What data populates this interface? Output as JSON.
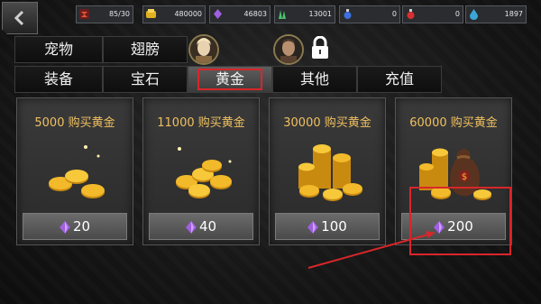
{
  "resources": [
    {
      "icon": "stamina-icon",
      "value": "85/30"
    },
    {
      "icon": "gold-coin-icon",
      "value": "480000"
    },
    {
      "icon": "purple-gem-icon",
      "value": "46803"
    },
    {
      "icon": "green-crystal-icon",
      "value": "13001"
    },
    {
      "icon": "blue-potion-icon",
      "value": "0"
    },
    {
      "icon": "red-potion-icon",
      "value": "0"
    },
    {
      "icon": "blue-drop-icon",
      "value": "1897"
    }
  ],
  "tabs_top": [
    {
      "label": "宠物"
    },
    {
      "label": "翅膀"
    }
  ],
  "tabs_bottom": [
    {
      "label": "装备"
    },
    {
      "label": "宝石"
    },
    {
      "label": "黄金",
      "active": true
    },
    {
      "label": "其他"
    },
    {
      "label": "充值"
    }
  ],
  "products": [
    {
      "title": "5000 购买黄金",
      "price": "20"
    },
    {
      "title": "11000 购买黄金",
      "price": "40"
    },
    {
      "title": "30000 购买黄金",
      "price": "100"
    },
    {
      "title": "60000 购买黄金",
      "price": "200"
    }
  ],
  "colors": {
    "gold_text": "#f0c060",
    "highlight_red": "#d9262a",
    "gem_purple": "#a060e0"
  }
}
